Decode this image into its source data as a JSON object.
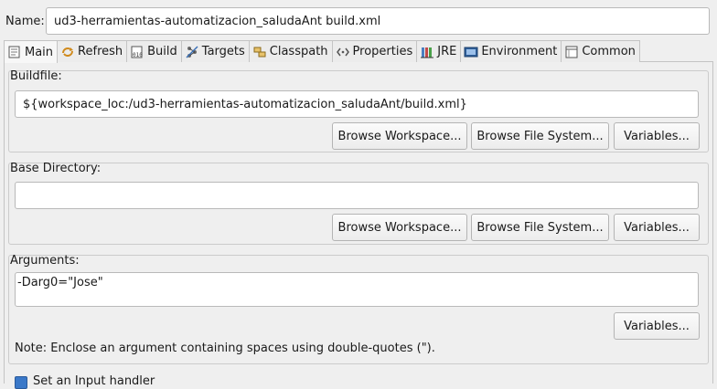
{
  "name_label": "Name:",
  "name_value": "ud3-herramientas-automatizacion_saludaAnt build.xml",
  "tabs": [
    {
      "label": "Main",
      "icon": "main-tab-icon"
    },
    {
      "label": "Refresh",
      "icon": "refresh-icon"
    },
    {
      "label": "Build",
      "icon": "build-icon"
    },
    {
      "label": "Targets",
      "icon": "targets-icon"
    },
    {
      "label": "Classpath",
      "icon": "classpath-icon"
    },
    {
      "label": "Properties",
      "icon": "properties-icon"
    },
    {
      "label": "JRE",
      "icon": "jre-icon"
    },
    {
      "label": "Environment",
      "icon": "environment-icon"
    },
    {
      "label": "Common",
      "icon": "common-icon"
    }
  ],
  "buildfile": {
    "title": "Buildfile:",
    "value": "${workspace_loc:/ud3-herramientas-automatizacion_saludaAnt/build.xml}",
    "browse_workspace": "Browse Workspace...",
    "browse_file_system": "Browse File System...",
    "variables": "Variables..."
  },
  "base_directory": {
    "title": "Base Directory:",
    "value": "",
    "browse_workspace": "Browse Workspace...",
    "browse_file_system": "Browse File System...",
    "variables": "Variables..."
  },
  "arguments": {
    "title": "Arguments:",
    "value": "-Darg0=\"Jose\"",
    "variables": "Variables...",
    "note": "Note: Enclose an argument containing spaces using double-quotes (\")."
  },
  "bottom_option": {
    "label": "Set an Input handler",
    "checked": true
  },
  "colors": {
    "background": "#efefef",
    "accent": "#3a78c8"
  }
}
